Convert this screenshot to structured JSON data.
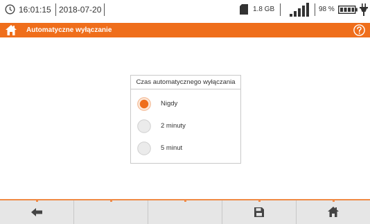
{
  "status_bar": {
    "time": "16:01:15",
    "date": "2018-07-20",
    "storage": "1.8 GB",
    "battery_percent": "98 %",
    "icons": [
      "clock-icon",
      "sd-card-icon",
      "signal-icon",
      "battery-icon",
      "plug-icon"
    ]
  },
  "header": {
    "title": "Automatyczne wyłączanie",
    "icons": [
      "home-icon",
      "help-icon"
    ],
    "background_color": "#ef6e1b"
  },
  "dialog": {
    "title": "Czas automatycznego wyłączania",
    "options": [
      {
        "label": "Nigdy",
        "selected": true
      },
      {
        "label": "2 minuty",
        "selected": false
      },
      {
        "label": "5 minut",
        "selected": false
      }
    ]
  },
  "toolbar": {
    "buttons": [
      {
        "name": "back",
        "icon": "back-arrow-icon"
      },
      {
        "name": "empty-2",
        "icon": ""
      },
      {
        "name": "empty-3",
        "icon": ""
      },
      {
        "name": "save",
        "icon": "save-icon"
      },
      {
        "name": "home",
        "icon": "home-icon"
      }
    ],
    "accent_color": "#f08a44"
  }
}
